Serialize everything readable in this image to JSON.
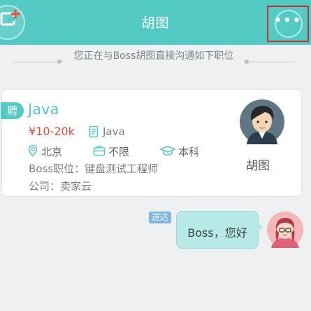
{
  "header": {
    "title": "胡图",
    "more_label": "•••"
  },
  "notice": {
    "text": "您正在与Boss胡图直接沟通如下职位"
  },
  "job_card": {
    "badge": "聘",
    "title": "Java",
    "salary": "¥10-20k",
    "category": "Java",
    "city": "北京",
    "experience": "不限",
    "education": "本科",
    "boss_position": "Boss职位：键盘测试工程师",
    "company": "公司：卖家云",
    "boss_name": "胡图"
  },
  "chat": {
    "status": "送达",
    "message": "Boss，您好"
  },
  "colors": {
    "accent": "#53cac3",
    "salary": "#ef4a3a",
    "bubble": "#b7e9e7",
    "status_badge": "#7db7ea"
  }
}
